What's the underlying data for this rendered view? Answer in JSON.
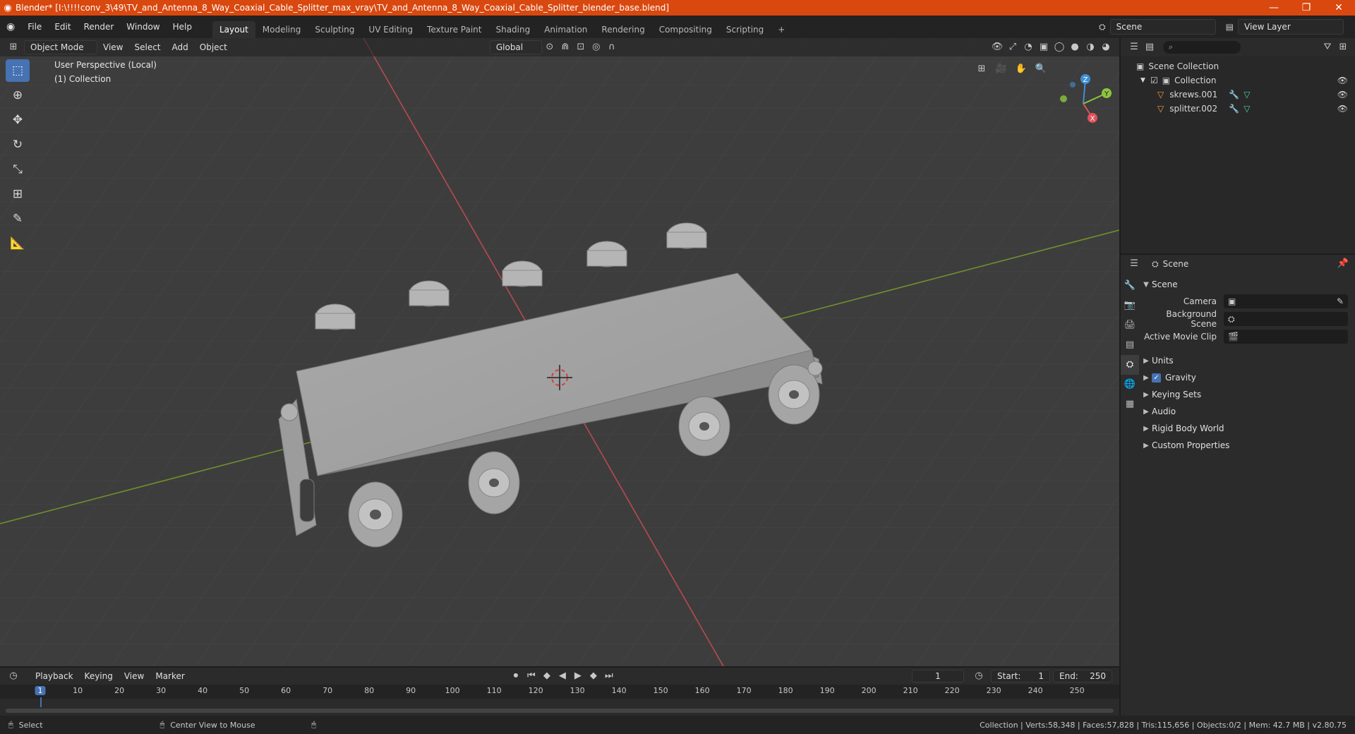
{
  "window": {
    "title": "Blender* [I:\\!!!!conv_3\\49\\TV_and_Antenna_8_Way_Coaxial_Cable_Splitter_max_vray\\TV_and_Antenna_8_Way_Coaxial_Cable_Splitter_blender_base.blend]",
    "minimize": "—",
    "restore": "❐",
    "close": "✕"
  },
  "menu": [
    "File",
    "Edit",
    "Render",
    "Window",
    "Help"
  ],
  "workspaces": [
    "Layout",
    "Modeling",
    "Sculpting",
    "UV Editing",
    "Texture Paint",
    "Shading",
    "Animation",
    "Rendering",
    "Compositing",
    "Scripting",
    "+"
  ],
  "scene_selector": "Scene",
  "view_layer_selector": "View Layer",
  "viewport": {
    "mode": "Object Mode",
    "menus": [
      "View",
      "Select",
      "Add",
      "Object"
    ],
    "orientation": "Global",
    "overlay_line1": "User Perspective (Local)",
    "overlay_line2": "(1) Collection",
    "gizmo": {
      "x": "X",
      "y": "Y",
      "z": "Z"
    }
  },
  "outliner": {
    "root": "Scene Collection",
    "collection": "Collection",
    "objects": [
      "skrews.001",
      "splitter.002"
    ]
  },
  "properties": {
    "header": "Scene",
    "panel": "Scene",
    "camera_label": "Camera",
    "background_scene_label": "Background Scene",
    "active_movie_clip_label": "Active Movie Clip",
    "sections": [
      "Units",
      "Gravity",
      "Keying Sets",
      "Audio",
      "Rigid Body World",
      "Custom Properties"
    ]
  },
  "timeline": {
    "menus": [
      "Playback",
      "Keying",
      "View",
      "Marker"
    ],
    "current_frame": "1",
    "start_label": "Start:",
    "start": "1",
    "end_label": "End:",
    "end": "250",
    "ticks": [
      "1",
      "10",
      "20",
      "30",
      "40",
      "50",
      "60",
      "70",
      "80",
      "90",
      "100",
      "110",
      "120",
      "130",
      "140",
      "150",
      "160",
      "170",
      "180",
      "190",
      "200",
      "210",
      "220",
      "230",
      "240",
      "250"
    ]
  },
  "status": {
    "left1": "Select",
    "left2": "Center View to Mouse",
    "right": "Collection | Verts:58,348 | Faces:57,828 | Tris:115,656 | Objects:0/2 | Mem: 42.7 MB | v2.80.75"
  },
  "colors": {
    "accent": "#4772b3",
    "titlebar": "#d9480f",
    "x_axis": "#e0515c",
    "y_axis": "#8cc63e",
    "z_axis": "#3f8fd6"
  }
}
